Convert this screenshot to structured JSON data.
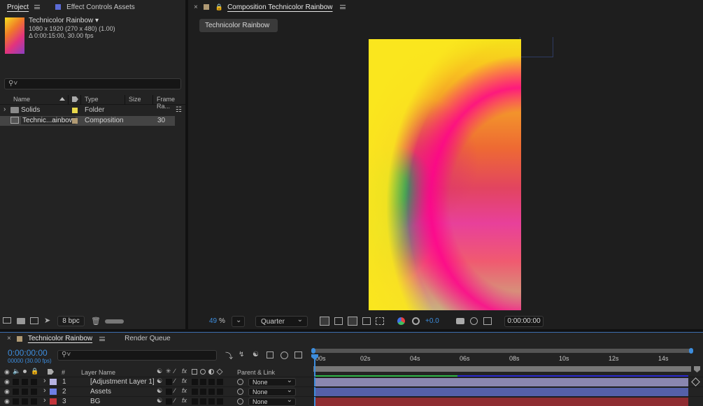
{
  "project_panel": {
    "tabs": [
      {
        "label": "Project",
        "active": true
      },
      {
        "label": "Effect Controls Assets",
        "active": false
      }
    ],
    "comp_name": "Technicolor Rainbow ▾",
    "comp_size": "1080 x 1920  (270 x 480) (1.00)",
    "comp_duration": "Δ 0:00:15:00, 30.00 fps",
    "search_placeholder": "",
    "columns": {
      "name": "Name",
      "type": "Type",
      "size": "Size",
      "frame_rate": "Frame Ra..."
    },
    "items": [
      {
        "name": "Solids",
        "type": "Folder",
        "size": "",
        "frame_rate": "",
        "color": "#e8d84a",
        "selected": false
      },
      {
        "name": "Technic...ainbow",
        "type": "Composition",
        "size": "",
        "frame_rate": "30",
        "color": "#b09a74",
        "selected": true
      }
    ],
    "bpc": "8 bpc"
  },
  "composition_panel": {
    "tab_label": "Composition Technicolor Rainbow",
    "comp_button": "Technicolor Rainbow",
    "zoom_value": "49",
    "zoom_unit": "%",
    "resolution": "Quarter",
    "exposure": "+0.0",
    "timecode": "0:00:00:00"
  },
  "timeline": {
    "tabs": [
      {
        "label": "Technicolor Rainbow",
        "active": true
      },
      {
        "label": "Render Queue",
        "active": false
      }
    ],
    "current_time": "0:00:00:00",
    "frame_info": "00000 (30.00 fps)",
    "ruler_labels": [
      "00s",
      "02s",
      "04s",
      "06s",
      "08s",
      "10s",
      "12s",
      "14s"
    ],
    "columns": {
      "num": "#",
      "layer_name": "Layer Name",
      "parent": "Parent & Link"
    },
    "layers": [
      {
        "num": "1",
        "name": "[Adjustment Layer 1]",
        "label_color": "#b6b3e2",
        "parent": "None",
        "bar_color": "#8a87b0"
      },
      {
        "num": "2",
        "name": "Assets",
        "label_color": "#6d7fe6",
        "parent": "None",
        "bar_color": "#5560a8"
      },
      {
        "num": "3",
        "name": "BG",
        "label_color": "#c2353b",
        "parent": "None",
        "bar_color": "#8e2c31"
      }
    ]
  },
  "colors": {
    "accent_blue": "#3d8ddd",
    "panel_bg": "#232323"
  }
}
